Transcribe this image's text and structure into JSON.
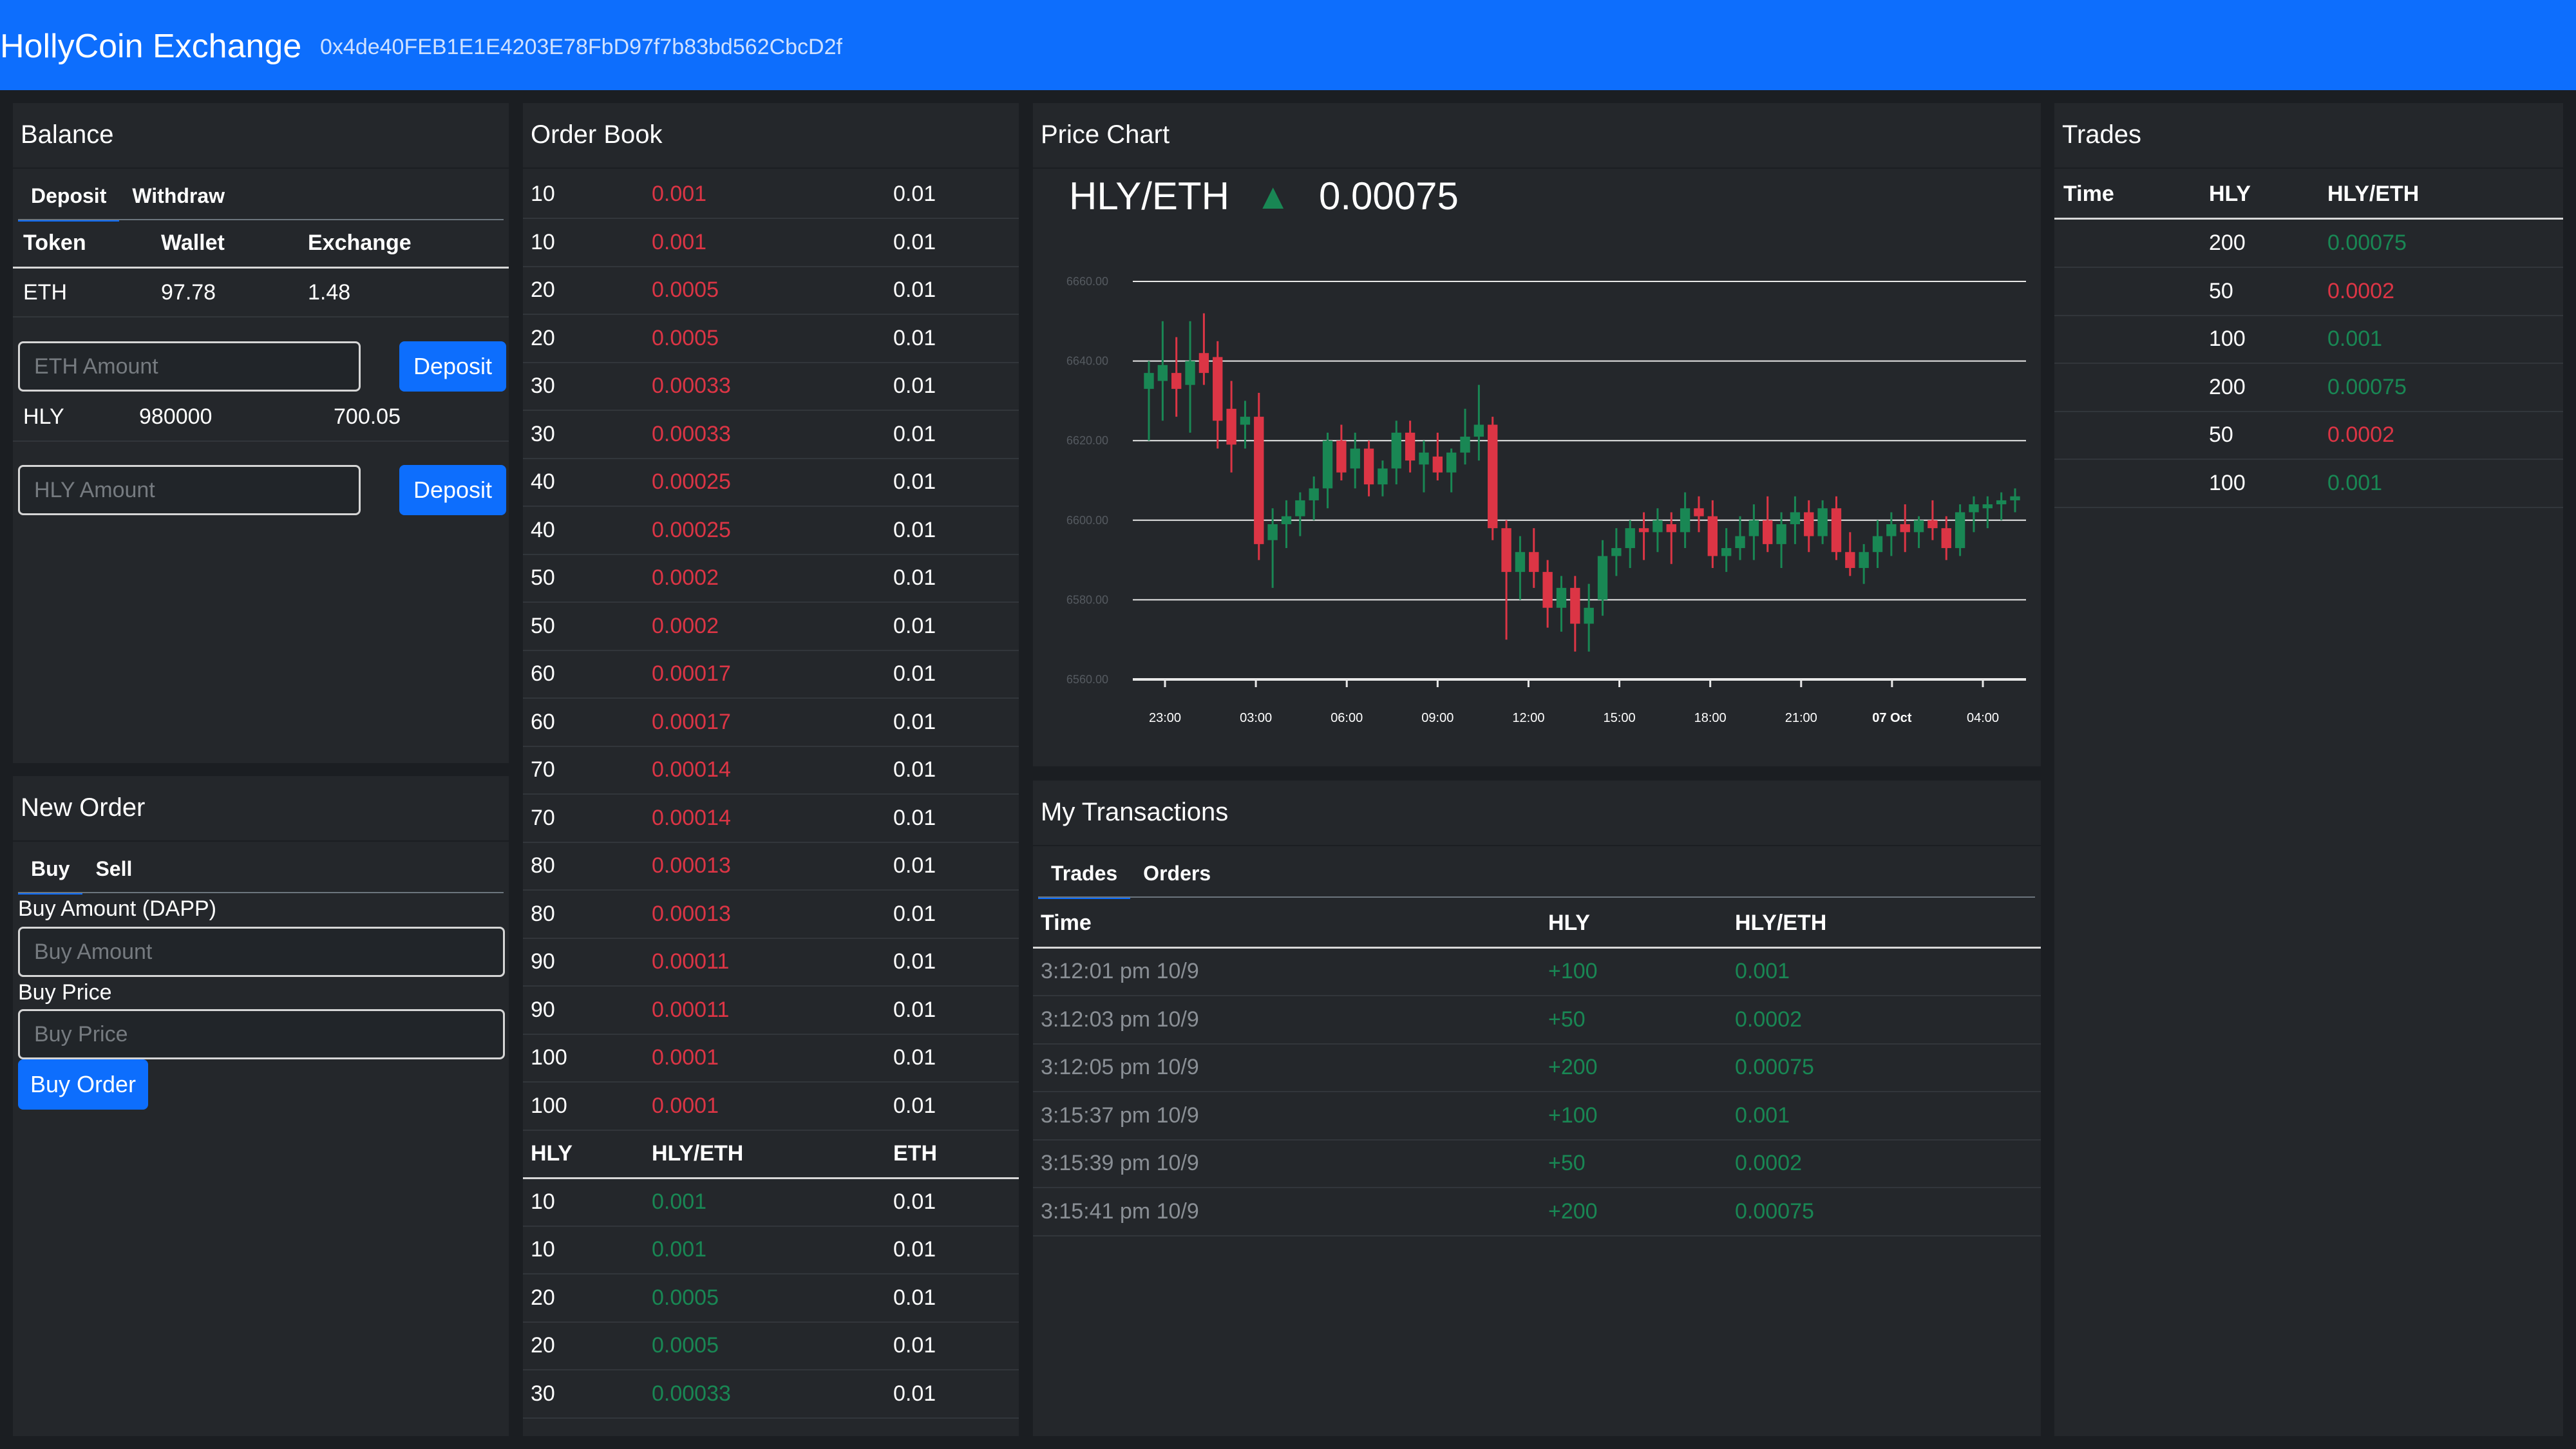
{
  "header": {
    "brand": "HollyCoin Exchange",
    "account": "0x4de40FEB1E1E4203E78FbD97f7b83bd562CbcD2f"
  },
  "balance": {
    "title": "Balance",
    "tabs": [
      "Deposit",
      "Withdraw"
    ],
    "columns": [
      "Token",
      "Wallet",
      "Exchange"
    ],
    "eth": {
      "token": "ETH",
      "wallet": "97.78",
      "exchange": "1.48",
      "placeholder": "ETH Amount",
      "button": "Deposit"
    },
    "hly": {
      "token": "HLY",
      "wallet": "980000",
      "exchange": "700.05",
      "placeholder": "HLY Amount",
      "button": "Deposit"
    }
  },
  "new_order": {
    "title": "New Order",
    "tabs": [
      "Buy",
      "Sell"
    ],
    "amount_label": "Buy Amount (DAPP)",
    "amount_placeholder": "Buy Amount",
    "price_label": "Buy Price",
    "price_placeholder": "Buy Price",
    "button": "Buy Order"
  },
  "order_book": {
    "title": "Order Book",
    "columns": [
      "HLY",
      "HLY/ETH",
      "ETH"
    ],
    "sell_orders": [
      [
        "10",
        "0.001",
        "0.01"
      ],
      [
        "10",
        "0.001",
        "0.01"
      ],
      [
        "20",
        "0.0005",
        "0.01"
      ],
      [
        "20",
        "0.0005",
        "0.01"
      ],
      [
        "30",
        "0.00033",
        "0.01"
      ],
      [
        "30",
        "0.00033",
        "0.01"
      ],
      [
        "40",
        "0.00025",
        "0.01"
      ],
      [
        "40",
        "0.00025",
        "0.01"
      ],
      [
        "50",
        "0.0002",
        "0.01"
      ],
      [
        "50",
        "0.0002",
        "0.01"
      ],
      [
        "60",
        "0.00017",
        "0.01"
      ],
      [
        "60",
        "0.00017",
        "0.01"
      ],
      [
        "70",
        "0.00014",
        "0.01"
      ],
      [
        "70",
        "0.00014",
        "0.01"
      ],
      [
        "80",
        "0.00013",
        "0.01"
      ],
      [
        "80",
        "0.00013",
        "0.01"
      ],
      [
        "90",
        "0.00011",
        "0.01"
      ],
      [
        "90",
        "0.00011",
        "0.01"
      ],
      [
        "100",
        "0.0001",
        "0.01"
      ],
      [
        "100",
        "0.0001",
        "0.01"
      ]
    ],
    "buy_orders": [
      [
        "10",
        "0.001",
        "0.01"
      ],
      [
        "10",
        "0.001",
        "0.01"
      ],
      [
        "20",
        "0.0005",
        "0.01"
      ],
      [
        "20",
        "0.0005",
        "0.01"
      ],
      [
        "30",
        "0.00033",
        "0.01"
      ]
    ]
  },
  "price_chart": {
    "title": "Price Chart",
    "pair": "HLY/ETH",
    "arrow": "▲",
    "last_price": "0.00075"
  },
  "chart_data": {
    "type": "candlestick",
    "y_ticks": [
      "6660.00",
      "6640.00",
      "6620.00",
      "6600.00",
      "6580.00",
      "6560.00"
    ],
    "ylim": [
      6560,
      6660
    ],
    "x_ticks": [
      "23:00",
      "03:00",
      "06:00",
      "09:00",
      "12:00",
      "15:00",
      "18:00",
      "21:00",
      "07 Oct",
      "04:00"
    ],
    "grid": true,
    "candles": [
      [
        6633,
        6640,
        6620,
        6637
      ],
      [
        6635,
        6650,
        6625,
        6639
      ],
      [
        6637,
        6646,
        6626,
        6633
      ],
      [
        6634,
        6650,
        6622,
        6640
      ],
      [
        6642,
        6652,
        6634,
        6637
      ],
      [
        6641,
        6645,
        6618,
        6625
      ],
      [
        6628,
        6635,
        6612,
        6619
      ],
      [
        6624,
        6630,
        6618,
        6626
      ],
      [
        6626,
        6632,
        6590,
        6594
      ],
      [
        6595,
        6603,
        6583,
        6599
      ],
      [
        6599,
        6605,
        6593,
        6601
      ],
      [
        6601,
        6607,
        6596,
        6605
      ],
      [
        6605,
        6611,
        6600,
        6608
      ],
      [
        6608,
        6622,
        6603,
        6620
      ],
      [
        6620,
        6624,
        6610,
        6612
      ],
      [
        6613,
        6622,
        6608,
        6618
      ],
      [
        6618,
        6620,
        6606,
        6609
      ],
      [
        6609,
        6615,
        6606,
        6613
      ],
      [
        6613,
        6625,
        6609,
        6622
      ],
      [
        6622,
        6625,
        6612,
        6615
      ],
      [
        6614,
        6620,
        6607,
        6617
      ],
      [
        6616,
        6622,
        6610,
        6612
      ],
      [
        6612,
        6618,
        6607,
        6617
      ],
      [
        6617,
        6628,
        6614,
        6621
      ],
      [
        6621,
        6634,
        6615,
        6624
      ],
      [
        6624,
        6626,
        6595,
        6598
      ],
      [
        6598,
        6600,
        6570,
        6587
      ],
      [
        6587,
        6596,
        6580,
        6592
      ],
      [
        6592,
        6598,
        6583,
        6587
      ],
      [
        6587,
        6590,
        6573,
        6578
      ],
      [
        6578,
        6586,
        6572,
        6583
      ],
      [
        6583,
        6586,
        6567,
        6574
      ],
      [
        6574,
        6584,
        6567,
        6578
      ],
      [
        6580,
        6595,
        6576,
        6591
      ],
      [
        6591,
        6598,
        6586,
        6593
      ],
      [
        6593,
        6600,
        6588,
        6598
      ],
      [
        6598,
        6602,
        6590,
        6597
      ],
      [
        6597,
        6603,
        6592,
        6600
      ],
      [
        6599,
        6602,
        6589,
        6597
      ],
      [
        6597,
        6607,
        6593,
        6603
      ],
      [
        6603,
        6606,
        6597,
        6601
      ],
      [
        6601,
        6605,
        6588,
        6591
      ],
      [
        6591,
        6598,
        6587,
        6593
      ],
      [
        6593,
        6601,
        6590,
        6596
      ],
      [
        6596,
        6604,
        6590,
        6600
      ],
      [
        6600,
        6606,
        6592,
        6594
      ],
      [
        6594,
        6602,
        6588,
        6599
      ],
      [
        6599,
        6606,
        6594,
        6602
      ],
      [
        6602,
        6605,
        6592,
        6596
      ],
      [
        6596,
        6605,
        6594,
        6603
      ],
      [
        6603,
        6606,
        6590,
        6592
      ],
      [
        6592,
        6597,
        6586,
        6588
      ],
      [
        6588,
        6594,
        6584,
        6592
      ],
      [
        6592,
        6600,
        6588,
        6596
      ],
      [
        6596,
        6602,
        6591,
        6599
      ],
      [
        6599,
        6604,
        6592,
        6597
      ],
      [
        6597,
        6601,
        6593,
        6600
      ],
      [
        6600,
        6605,
        6595,
        6598
      ],
      [
        6598,
        6601,
        6590,
        6593
      ],
      [
        6593,
        6604,
        6591,
        6602
      ],
      [
        6602,
        6606,
        6597,
        6604
      ],
      [
        6603,
        6606,
        6598,
        6604
      ],
      [
        6604,
        6607,
        6600,
        6605
      ],
      [
        6605,
        6608,
        6602,
        6606
      ]
    ]
  },
  "my_transactions": {
    "title": "My Transactions",
    "tabs": [
      "Trades",
      "Orders"
    ],
    "columns": [
      "Time",
      "HLY",
      "HLY/ETH"
    ],
    "rows": [
      [
        "3:12:01 pm 10/9",
        "+100",
        "0.001"
      ],
      [
        "3:12:03 pm 10/9",
        "+50",
        "0.0002"
      ],
      [
        "3:12:05 pm 10/9",
        "+200",
        "0.00075"
      ],
      [
        "3:15:37 pm 10/9",
        "+100",
        "0.001"
      ],
      [
        "3:15:39 pm 10/9",
        "+50",
        "0.0002"
      ],
      [
        "3:15:41 pm 10/9",
        "+200",
        "0.00075"
      ]
    ]
  },
  "trades": {
    "title": "Trades",
    "columns": [
      "Time",
      "HLY",
      "HLY/ETH"
    ],
    "rows": [
      [
        "",
        "200",
        "0.00075",
        "green"
      ],
      [
        "",
        "50",
        "0.0002",
        "red"
      ],
      [
        "",
        "100",
        "0.001",
        "green"
      ],
      [
        "",
        "200",
        "0.00075",
        "green"
      ],
      [
        "",
        "50",
        "0.0002",
        "red"
      ],
      [
        "",
        "100",
        "0.001",
        "green"
      ]
    ]
  },
  "colors": {
    "accent": "#0d6efd",
    "up": "#198754",
    "down": "#dc3545",
    "card": "#24272b",
    "background": "#1b1e22"
  }
}
